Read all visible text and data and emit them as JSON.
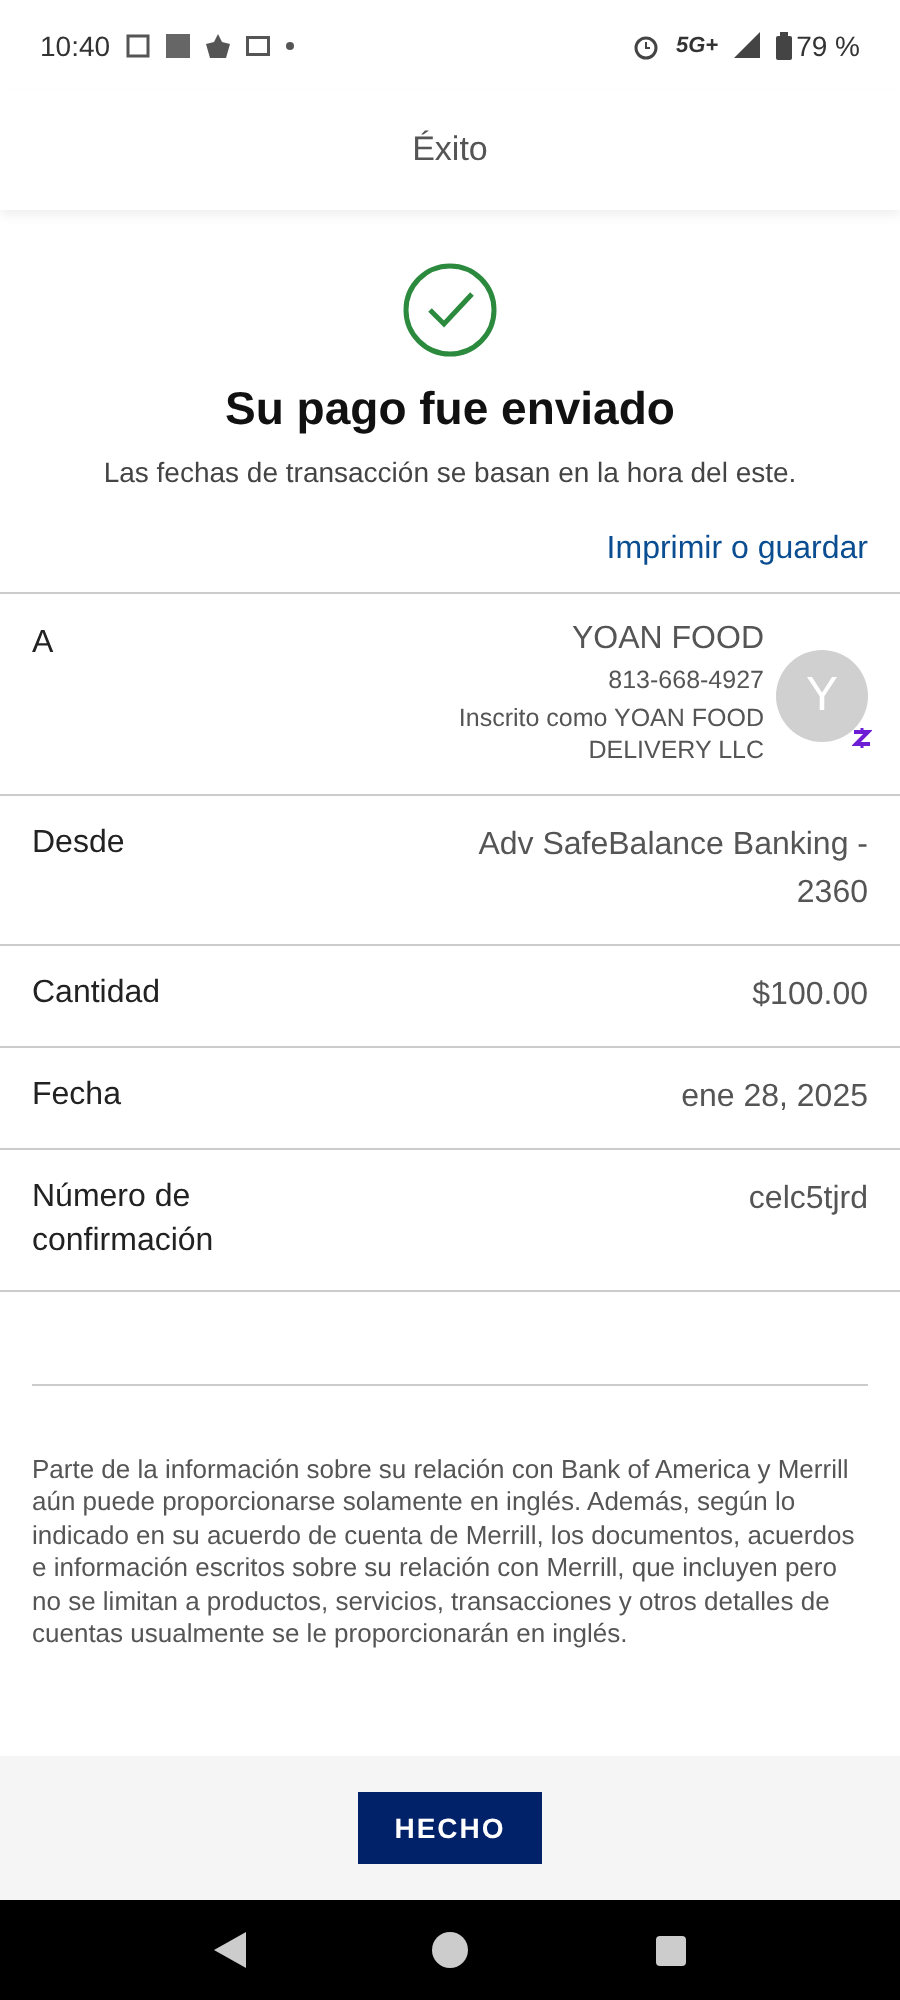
{
  "status_bar": {
    "time": "10:40",
    "network": "5G+",
    "battery": "79 %"
  },
  "header": {
    "title": "Éxito"
  },
  "confirmation": {
    "title": "Su pago fue enviado",
    "subtitle": "Las fechas de transacción se basan en la hora del este.",
    "print_link": "Imprimir o guardar"
  },
  "details": [
    {
      "kind": "recipient",
      "label": "A",
      "name": "YOAN FOOD",
      "phone": "813-668-4927",
      "enrolled": "Inscrito como YOAN FOOD DELIVERY LLC",
      "avatar": "Y"
    },
    {
      "kind": "plain",
      "label": "Desde",
      "value": "Adv SafeBalance Banking - 2360"
    },
    {
      "kind": "plain",
      "label": "Cantidad",
      "value": "$100.00"
    },
    {
      "kind": "plain",
      "label": "Fecha",
      "value": "ene 28, 2025"
    },
    {
      "kind": "plain",
      "label": "Número de confirmación",
      "value": "celc5tjrd"
    }
  ],
  "disclaimer": "Parte de la información sobre su relación con Bank of America y Merrill aún puede proporcionarse solamente en inglés. Además, según lo indicado en su acuerdo de cuenta de Merrill, los documentos, acuerdos e información escritos sobre su relación con Merrill, que incluyen pero no se limitan a productos, servicios, transacciones y otros detalles de cuentas usualmente se le proporcionarán en inglés.",
  "done_button": "HECHO"
}
